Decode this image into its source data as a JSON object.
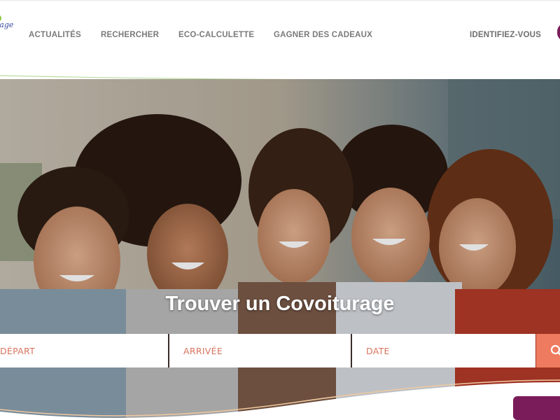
{
  "brand": {
    "logo_text": "rage"
  },
  "nav": {
    "items": [
      {
        "label": "ACTUALITÉS"
      },
      {
        "label": "RECHERCHER"
      },
      {
        "label": "ECO-CALCULETTE"
      },
      {
        "label": "GAGNER DES CADEAUX"
      }
    ],
    "signin_label": "IDENTIFIEZ-VOUS"
  },
  "hero": {
    "title": "Trouver un Covoiturage"
  },
  "search": {
    "departure_placeholder": "DÉPART",
    "arrival_placeholder": "ARRIVÉE",
    "date_placeholder": "DATE",
    "button_icon": "search-icon"
  },
  "colors": {
    "accent": "#ee7b5f",
    "brand_purple": "#7b1c5a",
    "brand_green": "#8cc63f",
    "brand_blue": "#3a4a9f",
    "nav_text": "#7a7a7a"
  }
}
